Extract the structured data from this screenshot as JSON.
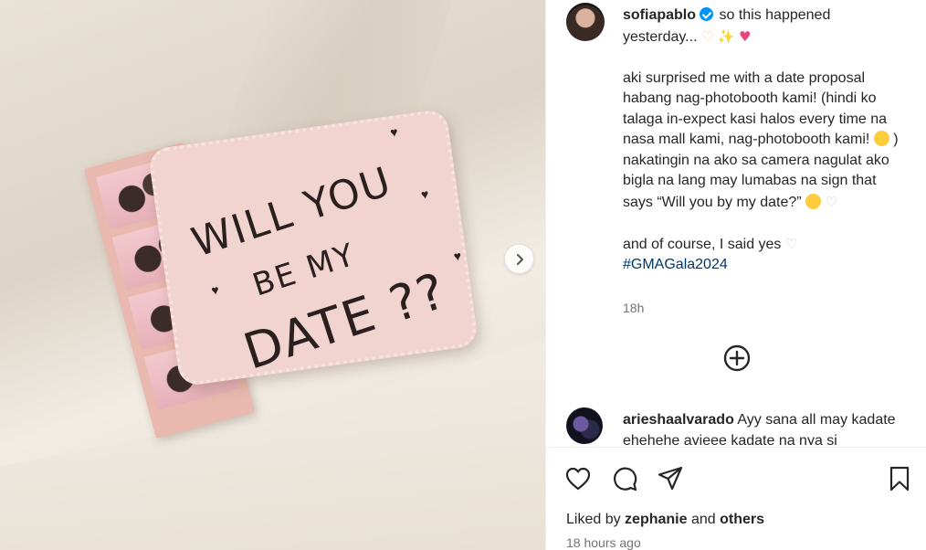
{
  "photo": {
    "card_lines": [
      "WILL YOU",
      "BE MY",
      "DATE ??"
    ]
  },
  "caption": {
    "username": "sofiapablo",
    "line1": "so this happened yesterday...",
    "body": "aki surprised me with a date proposal habang nag-photobooth kami! (hindi ko talaga in-expect kasi halos every time na nasa mall kami, nag-photobooth kami!",
    "body2": ") nakatingin na ako sa camera nagulat ako bigla na lang may lumabas na sign that says “Will you by my date?”",
    "closing": "and of course, I said yes",
    "hashtag": "#GMAGala2024",
    "time": "18h"
  },
  "comment": {
    "username": "arieshaalvarado",
    "text": "Ayy sana all may kadate ehehehe ayieee kadate na nya si"
  },
  "actions": {
    "liked_by_prefix": "Liked by",
    "liked_by_user": "zephanie",
    "and": "and",
    "others": "others",
    "post_time": "18 hours ago"
  },
  "icons": [
    "chevron-right-icon",
    "verified-badge-icon",
    "plus-circle-icon",
    "heart-icon",
    "comment-icon",
    "share-icon",
    "bookmark-icon"
  ],
  "colors": {
    "link": "#00376b",
    "verified": "#0095f6",
    "muted": "#737373",
    "text": "#262626"
  }
}
